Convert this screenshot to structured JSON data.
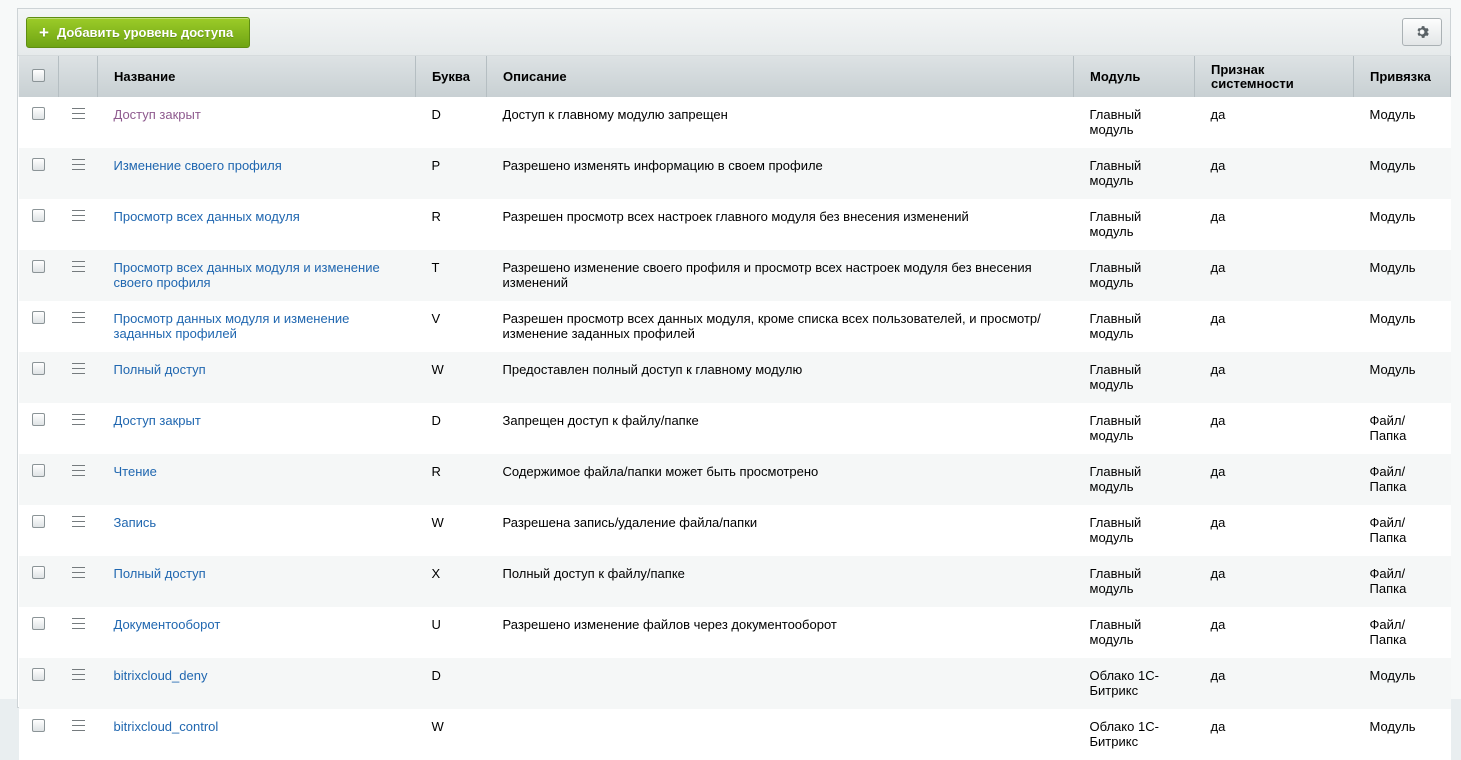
{
  "toolbar": {
    "add_label": "Добавить уровень доступа",
    "settings_icon": "gear-icon"
  },
  "columns": {
    "name": "Название",
    "letter": "Буква",
    "description": "Описание",
    "module": "Модуль",
    "system": "Признак системности",
    "binding": "Привязка"
  },
  "rows": [
    {
      "name": "Доступ закрыт",
      "letter": "D",
      "description": "Доступ к главному модулю запрещен",
      "module": "Главный модуль",
      "system": "да",
      "binding": "Модуль",
      "visited": true
    },
    {
      "name": "Изменение своего профиля",
      "letter": "P",
      "description": "Разрешено изменять информацию в своем профиле",
      "module": "Главный модуль",
      "system": "да",
      "binding": "Модуль"
    },
    {
      "name": "Просмотр всех данных модуля",
      "letter": "R",
      "description": "Разрешен просмотр всех настроек главного модуля без внесения изменений",
      "module": "Главный модуль",
      "system": "да",
      "binding": "Модуль"
    },
    {
      "name": "Просмотр всех данных модуля и изменение своего профиля",
      "letter": "T",
      "description": "Разрешено изменение своего профиля и просмотр всех настроек модуля без внесения изменений",
      "module": "Главный модуль",
      "system": "да",
      "binding": "Модуль"
    },
    {
      "name": "Просмотр данных модуля и изменение заданных профилей",
      "letter": "V",
      "description": "Разрешен просмотр всех данных модуля, кроме списка всех пользователей, и просмотр/изменение заданных профилей",
      "module": "Главный модуль",
      "system": "да",
      "binding": "Модуль"
    },
    {
      "name": "Полный доступ",
      "letter": "W",
      "description": "Предоставлен полный доступ к главному модулю",
      "module": "Главный модуль",
      "system": "да",
      "binding": "Модуль"
    },
    {
      "name": "Доступ закрыт",
      "letter": "D",
      "description": "Запрещен доступ к файлу/папке",
      "module": "Главный модуль",
      "system": "да",
      "binding": "Файл/ Папка"
    },
    {
      "name": "Чтение",
      "letter": "R",
      "description": "Содержимое файла/папки может быть просмотрено",
      "module": "Главный модуль",
      "system": "да",
      "binding": "Файл/ Папка"
    },
    {
      "name": "Запись",
      "letter": "W",
      "description": "Разрешена запись/удаление файла/папки",
      "module": "Главный модуль",
      "system": "да",
      "binding": "Файл/ Папка"
    },
    {
      "name": "Полный доступ",
      "letter": "X",
      "description": "Полный доступ к файлу/папке",
      "module": "Главный модуль",
      "system": "да",
      "binding": "Файл/ Папка"
    },
    {
      "name": "Документооборот",
      "letter": "U",
      "description": "Разрешено изменение файлов через документооборот",
      "module": "Главный модуль",
      "system": "да",
      "binding": "Файл/ Папка"
    },
    {
      "name": "bitrixcloud_deny",
      "letter": "D",
      "description": "",
      "module": "Облако 1С-Битрикс",
      "system": "да",
      "binding": "Модуль"
    },
    {
      "name": "bitrixcloud_control",
      "letter": "W",
      "description": "",
      "module": "Облако 1С-Битрикс",
      "system": "да",
      "binding": "Модуль"
    }
  ]
}
